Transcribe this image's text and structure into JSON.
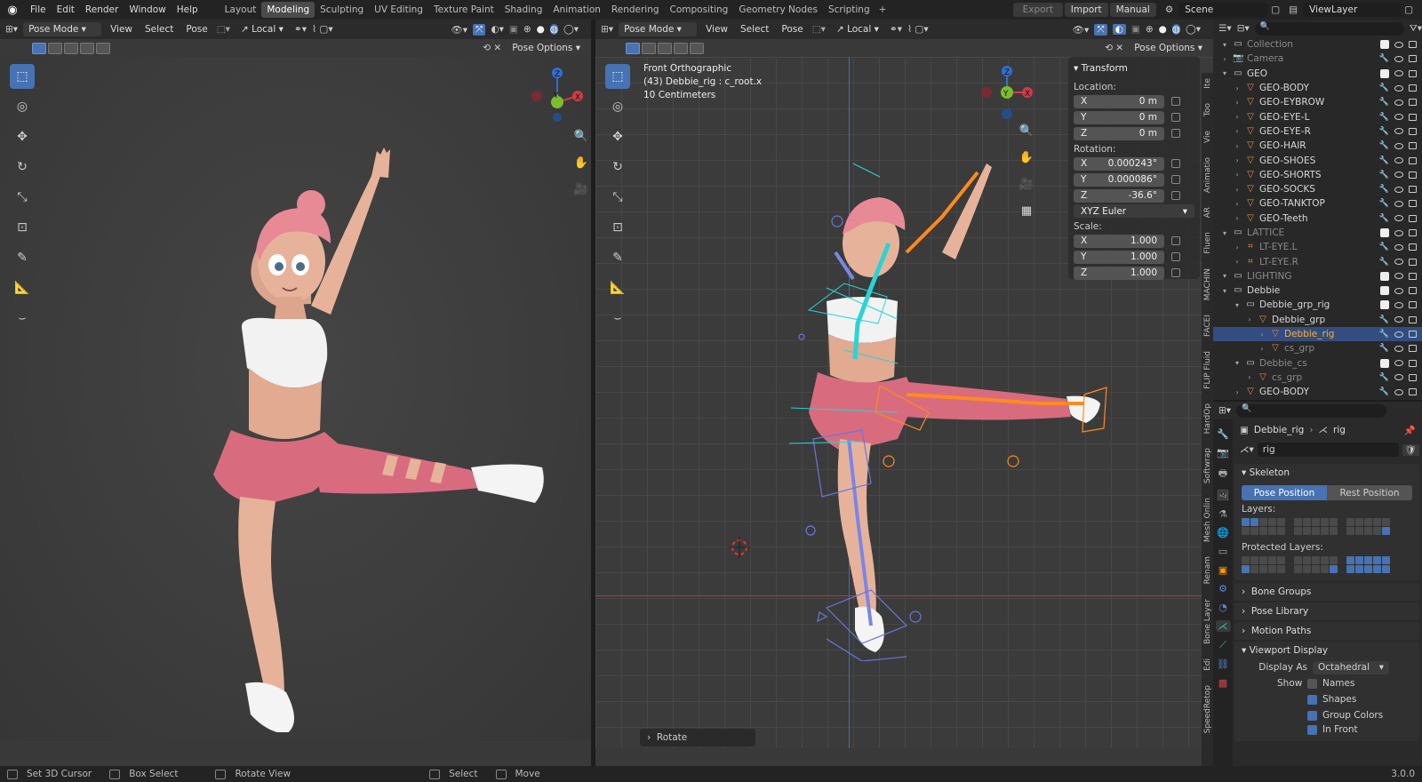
{
  "menu": [
    "File",
    "Edit",
    "Render",
    "Window",
    "Help"
  ],
  "workspaces": [
    "Layout",
    "Modeling",
    "Sculpting",
    "UV Editing",
    "Texture Paint",
    "Shading",
    "Animation",
    "Rendering",
    "Compositing",
    "Geometry Nodes",
    "Scripting"
  ],
  "active_workspace": "Modeling",
  "top_right": {
    "export": "Export",
    "import": "Import",
    "manual": "Manual",
    "scene": "Scene",
    "view_layer": "ViewLayer"
  },
  "left_viewport": {
    "mode": "Pose Mode",
    "menus": [
      "View",
      "Select",
      "Pose"
    ],
    "orientation": "Local",
    "pose_options": "Pose Options"
  },
  "right_viewport": {
    "mode": "Pose Mode",
    "menus": [
      "View",
      "Select",
      "Pose"
    ],
    "orientation": "Local",
    "pose_options": "Pose Options",
    "overlay_text": [
      "Front Orthographic",
      "(43) Debbie_rig : c_root.x",
      "10 Centimeters"
    ],
    "last_operator": "Rotate"
  },
  "gizmo": {
    "z": "Z",
    "y": "Y",
    "x": "X"
  },
  "npanel": {
    "title": "Transform",
    "location_label": "Location:",
    "location": [
      {
        "axis": "X",
        "value": "0 m"
      },
      {
        "axis": "Y",
        "value": "0 m"
      },
      {
        "axis": "Z",
        "value": "0 m"
      }
    ],
    "rotation_label": "Rotation:",
    "rotation": [
      {
        "axis": "X",
        "value": "0.000243°"
      },
      {
        "axis": "Y",
        "value": "0.000086°"
      },
      {
        "axis": "Z",
        "value": "-36.6°"
      }
    ],
    "rotation_mode": "XYZ Euler",
    "scale_label": "Scale:",
    "scale": [
      {
        "axis": "X",
        "value": "1.000"
      },
      {
        "axis": "Y",
        "value": "1.000"
      },
      {
        "axis": "Z",
        "value": "1.000"
      }
    ]
  },
  "npanel_tabs": [
    "Ite",
    "Too",
    "Vie",
    "Animatio",
    "AR",
    "Fluen",
    "MACHIN",
    "FACEI",
    "FLIP Fluid",
    "HardOp",
    "Softwrap",
    "Mesh Onlin",
    "Renam",
    "Bone Layer",
    "Edi",
    "SpeedRetop"
  ],
  "outliner": {
    "rows": [
      {
        "name": "Collection",
        "depth": 1,
        "dim": true
      },
      {
        "name": "Camera",
        "depth": 1,
        "dim": true
      },
      {
        "name": "GEO",
        "depth": 1,
        "dim": false
      },
      {
        "name": "GEO-BODY",
        "depth": 2,
        "dim": false
      },
      {
        "name": "GEO-EYBROW",
        "depth": 2,
        "dim": false
      },
      {
        "name": "GEO-EYE-L",
        "depth": 2,
        "dim": false
      },
      {
        "name": "GEO-EYE-R",
        "depth": 2,
        "dim": false
      },
      {
        "name": "GEO-HAIR",
        "depth": 2,
        "dim": false
      },
      {
        "name": "GEO-SHOES",
        "depth": 2,
        "dim": false
      },
      {
        "name": "GEO-SHORTS",
        "depth": 2,
        "dim": false
      },
      {
        "name": "GEO-SOCKS",
        "depth": 2,
        "dim": false
      },
      {
        "name": "GEO-TANKTOP",
        "depth": 2,
        "dim": false
      },
      {
        "name": "GEO-Teeth",
        "depth": 2,
        "dim": false
      },
      {
        "name": "LATTICE",
        "depth": 1,
        "dim": true
      },
      {
        "name": "LT-EYE.L",
        "depth": 2,
        "dim": true
      },
      {
        "name": "LT-EYE.R",
        "depth": 2,
        "dim": true
      },
      {
        "name": "LIGHTING",
        "depth": 1,
        "dim": true
      },
      {
        "name": "Debbie",
        "depth": 1,
        "dim": false
      },
      {
        "name": "Debbie_grp_rig",
        "depth": 2,
        "dim": false
      },
      {
        "name": "Debbie_grp",
        "depth": 3,
        "dim": false
      },
      {
        "name": "Debbie_rig",
        "depth": 4,
        "dim": false,
        "selected": true
      },
      {
        "name": "cs_grp",
        "depth": 4,
        "dim": true
      },
      {
        "name": "Debbie_cs",
        "depth": 2,
        "dim": true
      },
      {
        "name": "cs_grp",
        "depth": 3,
        "dim": true
      },
      {
        "name": "GEO-BODY",
        "depth": 2,
        "dim": false
      }
    ]
  },
  "properties": {
    "breadcrumb_obj": "Debbie_rig",
    "breadcrumb_data": "rig",
    "data_name": "rig",
    "skeleton": "Skeleton",
    "pose_position": "Pose Position",
    "rest_position": "Rest Position",
    "layers": "Layers:",
    "protected_layers": "Protected Layers:",
    "bone_groups": "Bone Groups",
    "pose_library": "Pose Library",
    "motion_paths": "Motion Paths",
    "viewport_display": "Viewport Display",
    "display_as_label": "Display As",
    "display_as": "Octahedral",
    "show": "Show",
    "names": "Names",
    "shapes": "Shapes",
    "group_colors": "Group Colors",
    "in_front": "In Front"
  },
  "status": {
    "set_cursor": "Set 3D Cursor",
    "box_select": "Box Select",
    "rotate_view": "Rotate View",
    "select": "Select",
    "move": "Move",
    "version": "3.0.0"
  },
  "colors": {
    "accent": "#4772b3",
    "selected_obj": "#ffaf29",
    "skin": "#e6b39a",
    "hair": "#e88a96",
    "shorts": "#d86c7e"
  }
}
